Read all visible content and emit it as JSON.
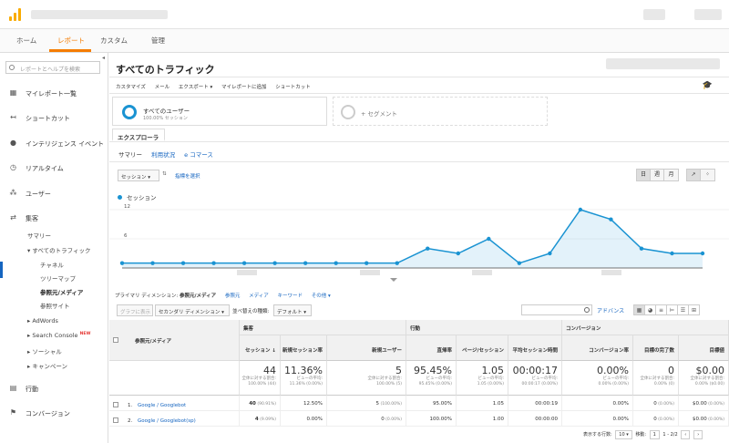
{
  "nav": {
    "tabs": [
      "ホーム",
      "レポート",
      "カスタム",
      "管理"
    ]
  },
  "sidebar": {
    "search_placeholder": "レポートとヘルプを検索",
    "items": [
      {
        "label": "マイレポート一覧",
        "icon": "dashboard-icon"
      },
      {
        "label": "ショートカット",
        "icon": "shortcut-icon"
      },
      {
        "label": "インテリジェンス イベント",
        "icon": "lightbulb-icon"
      },
      {
        "label": "リアルタイム",
        "icon": "realtime-icon"
      },
      {
        "label": "ユーザー",
        "icon": "users-icon"
      },
      {
        "label": "集客",
        "icon": "acquisition-icon"
      },
      {
        "label": "行動",
        "icon": "behavior-icon"
      },
      {
        "label": "コンバージョン",
        "icon": "flag-icon"
      }
    ],
    "sub": {
      "summary": "サマリー",
      "all_traffic": "▾ すべてのトラフィック",
      "channel": "チャネル",
      "treemap": "ツリーマップ",
      "referral_medium": "参照元/メディア",
      "referral_site": "参照サイト",
      "adwords": "▸ AdWords",
      "search_console": "▸ Search Console",
      "new_badge": "NEW",
      "social": "▸ ソーシャル",
      "campaign": "▸ キャンペーン"
    }
  },
  "main": {
    "title": "すべてのトラフィック",
    "actions": [
      "カスタマイズ",
      "メール",
      "エクスポート ▾",
      "マイレポートに追加",
      "ショートカット"
    ],
    "segment": {
      "name": "すべてのユーザー",
      "sub": "100.00% セッション",
      "add": "+ セグメント"
    },
    "explorer_tab": "エクスプローラ",
    "subtabs": [
      "サマリー",
      "利用状況",
      "e コマース"
    ],
    "metric_dropdown": "セッション",
    "metric_select": "指標を選択",
    "period_buttons": [
      "日",
      "週",
      "月"
    ],
    "primary_dim_label": "プライマリ ディメンション:",
    "primary_dim_value": "参照元/メディア",
    "dim_links": [
      "参照元",
      "メディア",
      "キーワード",
      "その他 ▾"
    ],
    "plot_rows": "グラフに表示",
    "secondary_dim": "セカンダリ ディメンション ▾",
    "sort_type_label": "並べ替えの種類:",
    "sort_type_value": "デフォルト ▾",
    "advanced": "アドバンス"
  },
  "chart_data": {
    "type": "area",
    "series": [
      {
        "name": "セッション",
        "values": [
          1,
          1,
          1,
          1,
          1,
          1,
          1,
          1,
          1,
          1,
          4,
          3,
          6,
          1,
          3,
          12,
          10,
          4,
          3,
          3
        ]
      }
    ],
    "ylim": [
      0,
      12
    ],
    "yticks": [
      6,
      12
    ]
  },
  "table": {
    "group_headers": [
      "集客",
      "行動",
      "コンバージョン"
    ],
    "dim_header": "参照元/メディア",
    "columns": [
      "セッション",
      "新規セッション率",
      "新規ユーザー",
      "直帰率",
      "ページ/セッション",
      "平均セッション時間",
      "コンバージョン率",
      "目標の完了数",
      "目標値"
    ],
    "totals": [
      {
        "big": "44",
        "s1": "全体に対する割合:",
        "s2": "100.00% (44)"
      },
      {
        "big": "11.36%",
        "s1": "ビューの平均:",
        "s2": "11.36% (0.00%)"
      },
      {
        "big": "5",
        "s1": "全体に対する割合:",
        "s2": "100.00% (5)"
      },
      {
        "big": "95.45%",
        "s1": "ビューの平均:",
        "s2": "95.45% (0.00%)"
      },
      {
        "big": "1.05",
        "s1": "ビューの平均:",
        "s2": "1.05 (0.00%)"
      },
      {
        "big": "00:00:17",
        "s1": "ビューの平均:",
        "s2": "00:00:17 (0.00%)"
      },
      {
        "big": "0.00%",
        "s1": "ビューの平均:",
        "s2": "0.00% (0.00%)"
      },
      {
        "big": "0",
        "s1": "全体に対する割合:",
        "s2": "0.00% (0)"
      },
      {
        "big": "$0.00",
        "s1": "全体に対する割合:",
        "s2": "0.00% ($0.00)"
      }
    ],
    "rows": [
      {
        "num": "1.",
        "name": "Google / Googlebot",
        "sessions": "40",
        "sessions_pct": "(90.91%)",
        "new_rate": "12.50%",
        "new_users": "5",
        "new_users_pct": "(100.00%)",
        "bounce": "95.00%",
        "pps": "1.05",
        "dur": "00:00:19",
        "conv": "0.00%",
        "goals": "0",
        "goals_pct": "(0.00%)",
        "value": "$0.00",
        "value_pct": "(0.00%)"
      },
      {
        "num": "2.",
        "name": "Google / Googlebot(sp)",
        "sessions": "4",
        "sessions_pct": "(9.09%)",
        "new_rate": "0.00%",
        "new_users": "0",
        "new_users_pct": "(0.00%)",
        "bounce": "100.00%",
        "pps": "1.00",
        "dur": "00:00:00",
        "conv": "0.00%",
        "goals": "0",
        "goals_pct": "(0.00%)",
        "value": "$0.00",
        "value_pct": "(0.00%)"
      }
    ]
  },
  "pager": {
    "rows_label": "表示する行数:",
    "rows_value": "10",
    "goto_label": "移動:",
    "goto_value": "1",
    "range": "1 - 2/2"
  },
  "colors": {
    "accent": "#f57c00",
    "series": "#1a93d2",
    "link": "#1565c0"
  }
}
